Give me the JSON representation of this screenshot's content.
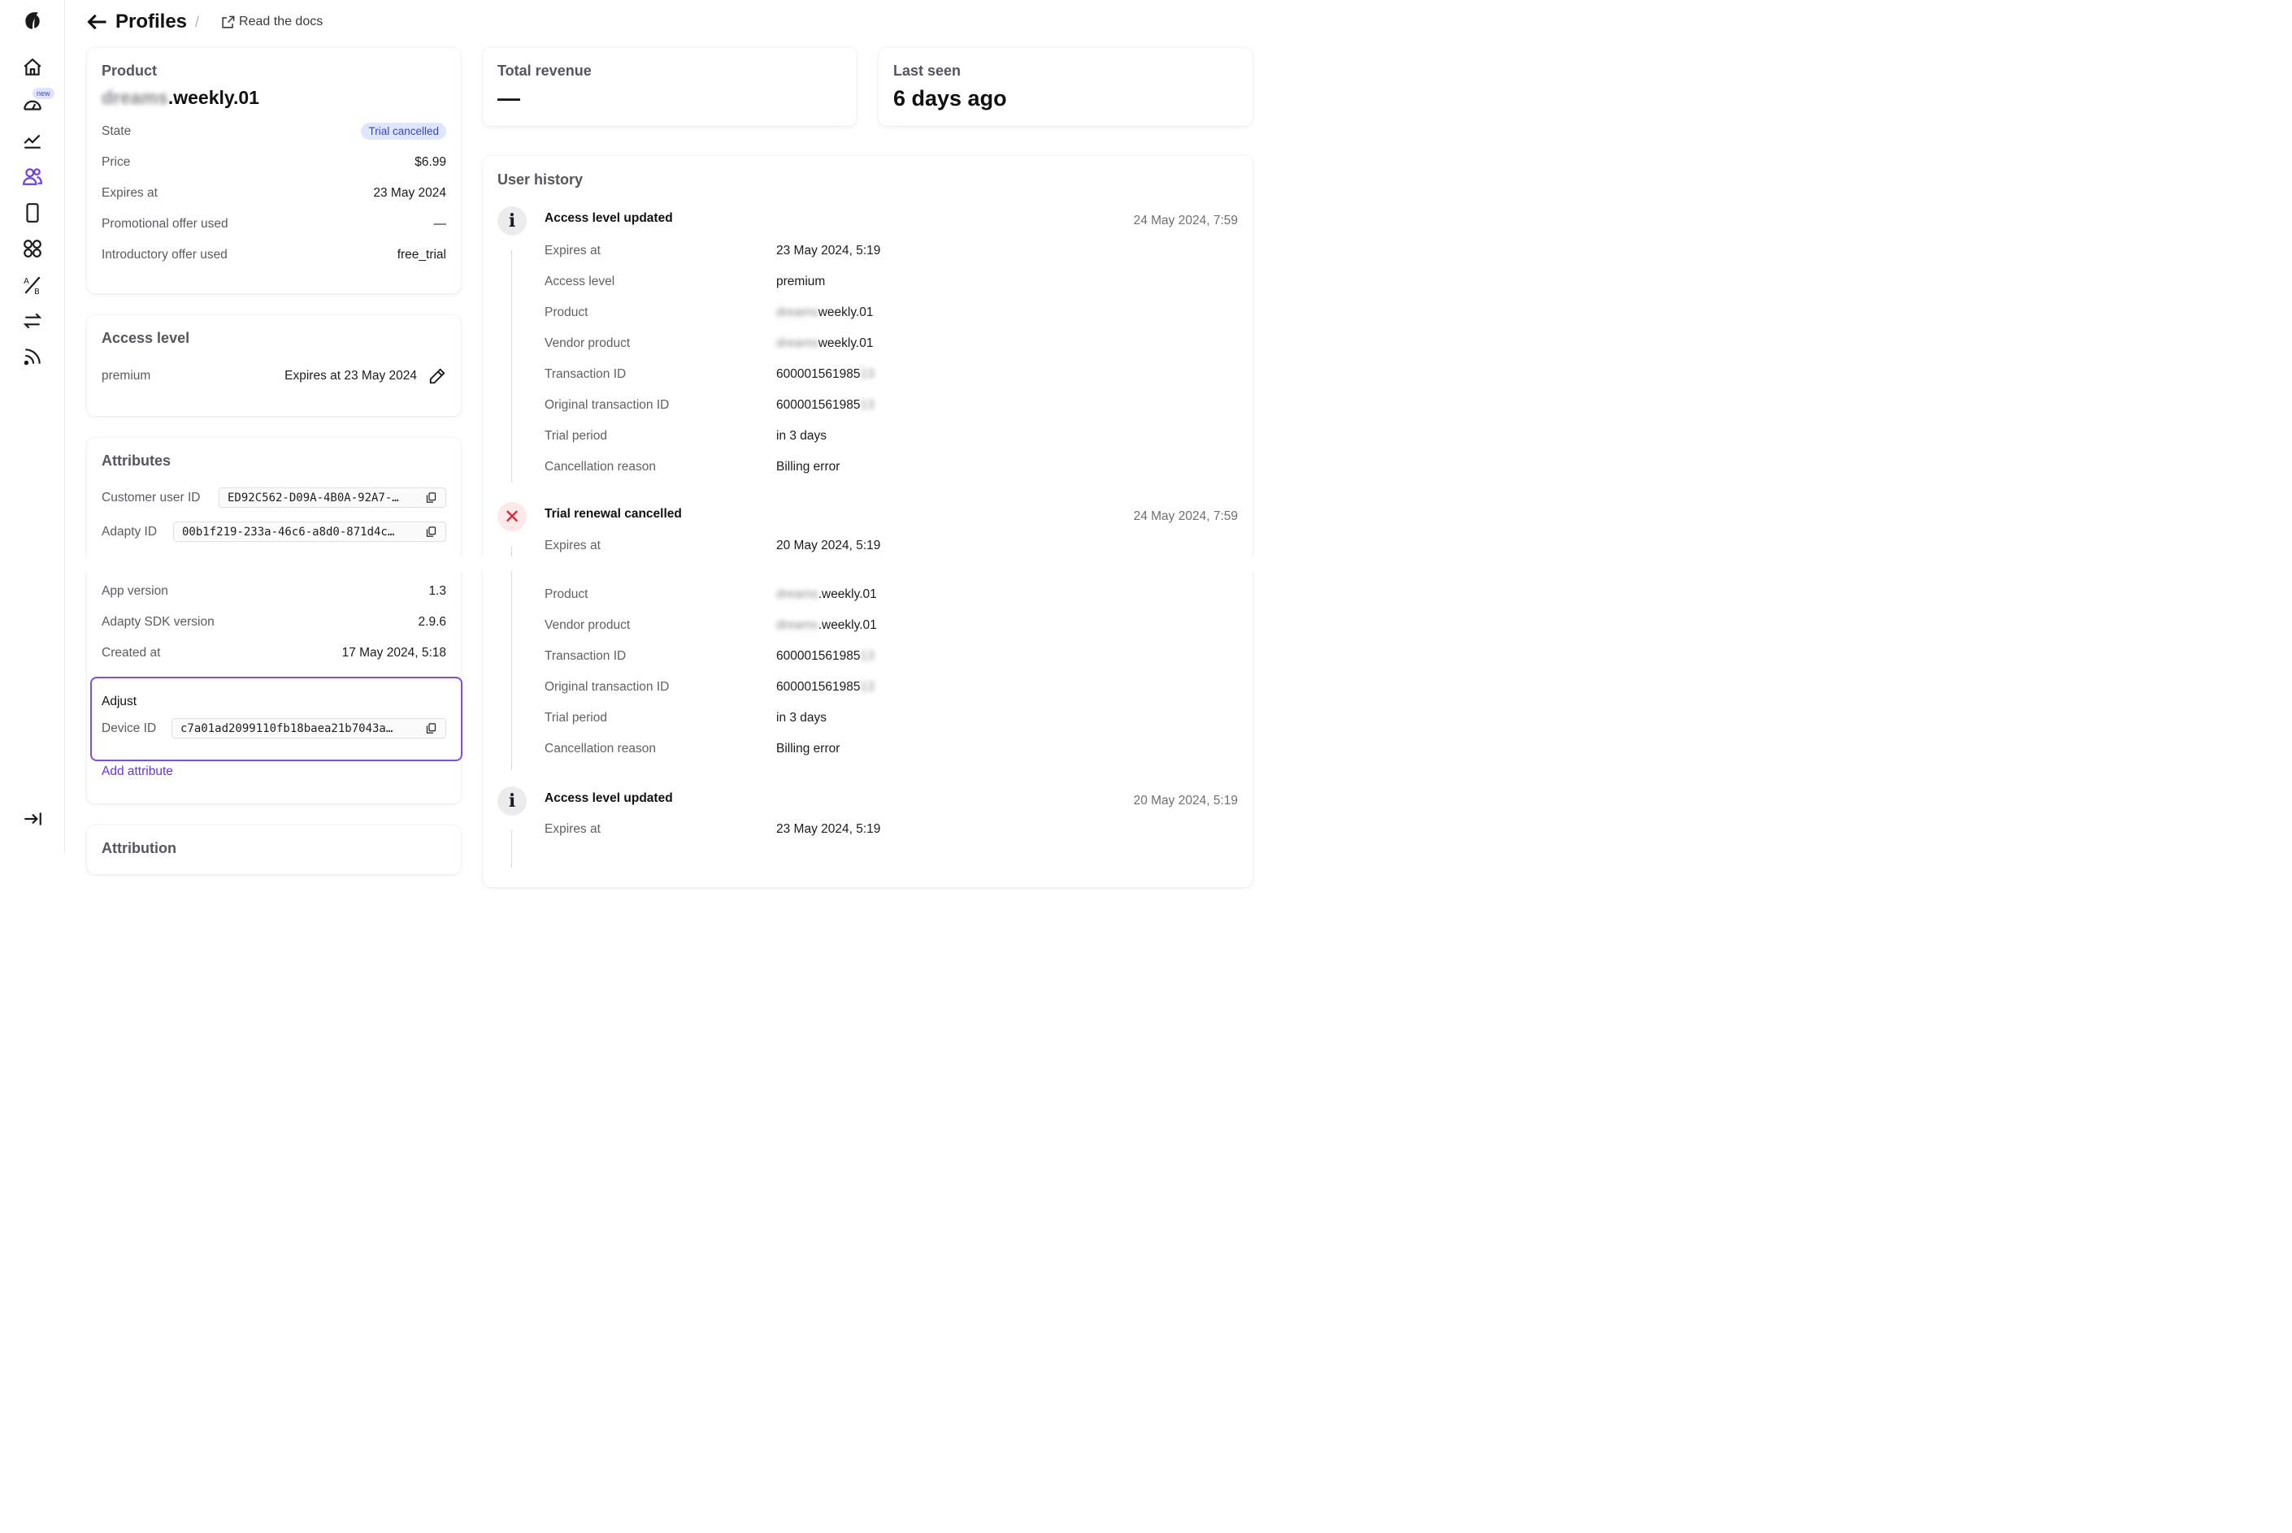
{
  "sidebar": {
    "new_badge": "new",
    "icons": [
      "logo-icon",
      "home-icon",
      "speedometer-icon",
      "chart-line-icon",
      "users-icon",
      "phone-icon",
      "apps-grid-icon",
      "ab-test-icon",
      "swap-arrows-icon",
      "rss-icon",
      "collapse-sidebar-icon"
    ],
    "active": "users-icon",
    "accent": "#6c3ce9"
  },
  "header": {
    "title": "Profiles",
    "separator": "/",
    "docs_link": "Read the docs"
  },
  "product_card": {
    "label": "Product",
    "name_blurred": "dreams",
    "name_suffix": ".weekly.01",
    "state_label": "State",
    "state_badge": "Trial cancelled",
    "price_label": "Price",
    "price_value": "$6.99",
    "expires_label": "Expires at",
    "expires_value": "23 May 2024",
    "promo_label": "Promotional offer used",
    "promo_value": "—",
    "intro_label": "Introductory offer used",
    "intro_value": "free_trial"
  },
  "access_card": {
    "title": "Access level",
    "level": "premium",
    "expires": "Expires at 23 May 2024"
  },
  "attributes_card": {
    "title": "Attributes",
    "customer_user_id_label": "Customer user ID",
    "customer_user_id_value": "ED92C562-D09A-4B0A-92A7-…",
    "adapty_id_label": "Adapty ID",
    "adapty_id_value": "00b1f219-233a-46c6-a8d0-871d4c…",
    "app_version_label": "App version",
    "app_version_value": "1.3",
    "sdk_label": "Adapty SDK version",
    "sdk_value": "2.9.6",
    "created_label": "Created at",
    "created_value": "17 May 2024, 5:18",
    "adjust_title": "Adjust",
    "device_id_label": "Device ID",
    "device_id_value": "c7a01ad2099110fb18baea21b7043a…",
    "add_attribute": "Add attribute"
  },
  "attribution_card": {
    "title": "Attribution"
  },
  "revenue_card": {
    "label": "Total revenue",
    "value": "—"
  },
  "last_seen_card": {
    "label": "Last seen",
    "value": "6 days ago"
  },
  "history": {
    "title": "User history",
    "events": [
      {
        "title": "Access level updated",
        "time": "24 May 2024, 7:59",
        "rows": [
          {
            "k": "Expires at",
            "v": "23 May 2024, 5:19"
          },
          {
            "k": "Access level",
            "v": "premium"
          },
          {
            "k": "Product",
            "v_blur": "dreams",
            "v": "weekly.01"
          },
          {
            "k": "Vendor product",
            "v_blur": "dreams",
            "v": "weekly.01"
          },
          {
            "k": "Transaction ID",
            "v": "600001561985",
            "v_blur_after": "8",
            "_tail": "13"
          },
          {
            "k": "Original transaction ID",
            "v": "600001561985",
            "v_blur_after": "8",
            "_tail": "13"
          },
          {
            "k": "Trial period",
            "v": "in 3 days"
          },
          {
            "k": "Cancellation reason",
            "v": "Billing error"
          }
        ]
      },
      {
        "title": "Trial renewal cancelled",
        "time": "24 May 2024, 7:59",
        "rows": [
          {
            "k": "Expires at",
            "v": "20 May 2024, 5:19"
          },
          {
            "k": "Product",
            "v_blur": "dreams",
            "v": ".weekly.01"
          },
          {
            "k": "Vendor product",
            "v_blur": "dreams",
            "v": ".weekly.01"
          },
          {
            "k": "Transaction ID",
            "v": "600001561985",
            "_tail": "13"
          },
          {
            "k": "Original transaction ID",
            "v": "600001561985",
            "_tail": "13"
          },
          {
            "k": "Trial period",
            "v": "in 3 days"
          },
          {
            "k": "Cancellation reason",
            "v": "Billing error"
          }
        ]
      },
      {
        "title": "Access level updated",
        "time": "20 May 2024, 5:19",
        "rows": [
          {
            "k": "Expires at",
            "v": "23 May 2024, 5:19"
          }
        ]
      }
    ]
  }
}
